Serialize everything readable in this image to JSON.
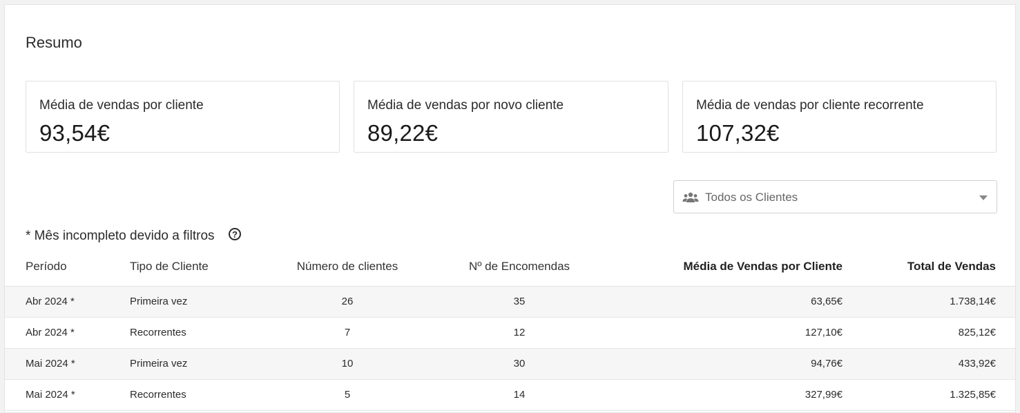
{
  "summary": {
    "title": "Resumo",
    "cards": [
      {
        "label": "Média de vendas por cliente",
        "value": "93,54€"
      },
      {
        "label": "Média de vendas por novo cliente",
        "value": "89,22€"
      },
      {
        "label": "Média de vendas por cliente recorrente",
        "value": "107,32€"
      }
    ]
  },
  "filter": {
    "selected": "Todos os Clientes",
    "icon": "people-icon"
  },
  "note": {
    "text": "* Mês incompleto devido a filtros",
    "icon": "help-circle-icon",
    "icon_glyph": "?"
  },
  "table": {
    "headers": {
      "periodo": "Período",
      "tipo": "Tipo de Cliente",
      "numero": "Número de clientes",
      "encomendas": "Nº de Encomendas",
      "media": "Média de Vendas por Cliente",
      "total": "Total de Vendas"
    },
    "rows": [
      {
        "periodo": "Abr 2024 *",
        "tipo": "Primeira vez",
        "numero": "26",
        "encomendas": "35",
        "media": "63,65€",
        "total": "1.738,14€"
      },
      {
        "periodo": "Abr 2024 *",
        "tipo": "Recorrentes",
        "numero": "7",
        "encomendas": "12",
        "media": "127,10€",
        "total": "825,12€"
      },
      {
        "periodo": "Mai 2024 *",
        "tipo": "Primeira vez",
        "numero": "10",
        "encomendas": "30",
        "media": "94,76€",
        "total": "433,92€"
      },
      {
        "periodo": "Mai 2024 *",
        "tipo": "Recorrentes",
        "numero": "5",
        "encomendas": "14",
        "media": "327,99€",
        "total": "1.325,85€"
      }
    ]
  }
}
